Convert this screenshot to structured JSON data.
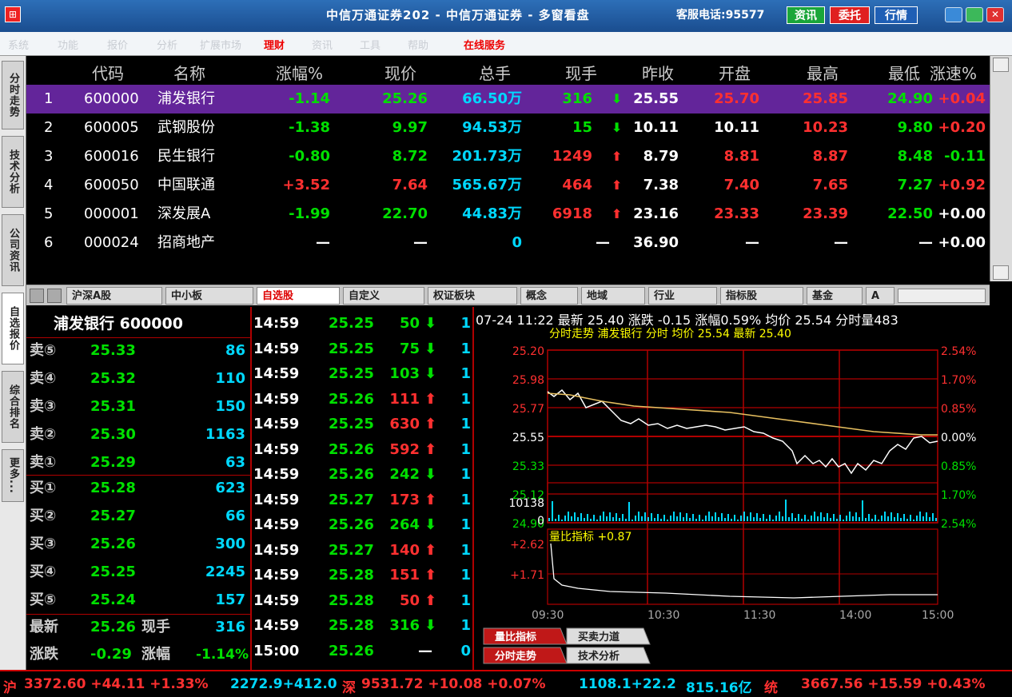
{
  "window": {
    "title": "中信万通证券202 - 中信万通证券 - 多窗看盘",
    "service_phone": "客服电话:95577",
    "btn_info": "资讯",
    "btn_order": "委托",
    "btn_quote": "行情"
  },
  "menu": {
    "items": [
      "系统",
      "功能",
      "报价",
      "分析",
      "扩展市场",
      "理财",
      "资讯",
      "工具",
      "在线服务",
      "帮助"
    ],
    "highlight_1": "理财",
    "highlight_2": "在线服务"
  },
  "left_tabs": [
    "分时走势",
    "技术分析",
    "公司资讯",
    "自选报价",
    "综合排名",
    "更多..."
  ],
  "quote_table": {
    "headers": [
      "代码",
      "名称",
      "涨幅%",
      "现价",
      "总手",
      "现手",
      "昨收",
      "开盘",
      "最高",
      "最低",
      "涨速%"
    ],
    "rows": [
      {
        "idx": "1",
        "code": "600000",
        "name": "浦发银行",
        "chg": "-1.14",
        "price": "25.26",
        "vol": "66.50万",
        "cur": "316",
        "dir": "down",
        "prev": "25.55",
        "open": "25.70",
        "high": "25.85",
        "low": "24.90",
        "speed": "+0.04"
      },
      {
        "idx": "2",
        "code": "600005",
        "name": "武钢股份",
        "chg": "-1.38",
        "price": "9.97",
        "vol": "94.53万",
        "cur": "15",
        "dir": "down",
        "prev": "10.11",
        "open": "10.11",
        "high": "10.23",
        "low": "9.80",
        "speed": "+0.20"
      },
      {
        "idx": "3",
        "code": "600016",
        "name": "民生银行",
        "chg": "-0.80",
        "price": "8.72",
        "vol": "201.73万",
        "cur": "1249",
        "dir": "up",
        "prev": "8.79",
        "open": "8.81",
        "high": "8.87",
        "low": "8.48",
        "speed": "-0.11"
      },
      {
        "idx": "4",
        "code": "600050",
        "name": "中国联通",
        "chg": "+3.52",
        "price": "7.64",
        "vol": "565.67万",
        "cur": "464",
        "dir": "up",
        "prev": "7.38",
        "open": "7.40",
        "high": "7.65",
        "low": "7.27",
        "speed": "+0.92"
      },
      {
        "idx": "5",
        "code": "000001",
        "name": "深发展A",
        "chg": "-1.99",
        "price": "22.70",
        "vol": "44.83万",
        "cur": "6918",
        "dir": "up",
        "prev": "23.16",
        "open": "23.33",
        "high": "23.39",
        "low": "22.50",
        "speed": "+0.00"
      },
      {
        "idx": "6",
        "code": "000024",
        "name": "招商地产",
        "chg": "—",
        "price": "—",
        "vol": "0",
        "cur": "—",
        "dir": "none",
        "prev": "36.90",
        "open": "—",
        "high": "—",
        "low": "—",
        "speed": "+0.00"
      }
    ]
  },
  "sheet_tabs": [
    "沪深A股",
    "中小板",
    "自选股",
    "自定义",
    "权证板块",
    "概念",
    "地域",
    "行业",
    "指标股",
    "基金",
    "A"
  ],
  "order_book": {
    "title": "浦发银行 600000",
    "sells": [
      {
        "label": "卖⑤",
        "price": "25.33",
        "vol": "86"
      },
      {
        "label": "卖④",
        "price": "25.32",
        "vol": "110"
      },
      {
        "label": "卖③",
        "price": "25.31",
        "vol": "150"
      },
      {
        "label": "卖②",
        "price": "25.30",
        "vol": "1163"
      },
      {
        "label": "卖①",
        "price": "25.29",
        "vol": "63"
      }
    ],
    "buys": [
      {
        "label": "买①",
        "price": "25.28",
        "vol": "623"
      },
      {
        "label": "买②",
        "price": "25.27",
        "vol": "66"
      },
      {
        "label": "买③",
        "price": "25.26",
        "vol": "300"
      },
      {
        "label": "买④",
        "price": "25.25",
        "vol": "2245"
      },
      {
        "label": "买⑤",
        "price": "25.24",
        "vol": "157"
      }
    ],
    "latest_label": "最新",
    "latest": "25.26",
    "cur_label": "现手",
    "cur": "316",
    "chg_label": "涨跌",
    "chg": "-0.29",
    "pct_label": "涨幅",
    "pct": "-1.14%"
  },
  "ticks": [
    {
      "t": "14:59",
      "p": "25.25",
      "v": "50",
      "d": "down",
      "n": "1"
    },
    {
      "t": "14:59",
      "p": "25.25",
      "v": "75",
      "d": "down",
      "n": "1"
    },
    {
      "t": "14:59",
      "p": "25.25",
      "v": "103",
      "d": "down",
      "n": "1"
    },
    {
      "t": "14:59",
      "p": "25.26",
      "v": "111",
      "d": "up",
      "n": "1"
    },
    {
      "t": "14:59",
      "p": "25.25",
      "v": "630",
      "d": "up",
      "n": "1"
    },
    {
      "t": "14:59",
      "p": "25.26",
      "v": "592",
      "d": "up",
      "n": "1"
    },
    {
      "t": "14:59",
      "p": "25.26",
      "v": "242",
      "d": "down",
      "n": "1"
    },
    {
      "t": "14:59",
      "p": "25.27",
      "v": "173",
      "d": "up",
      "n": "1"
    },
    {
      "t": "14:59",
      "p": "25.26",
      "v": "264",
      "d": "down",
      "n": "1"
    },
    {
      "t": "14:59",
      "p": "25.27",
      "v": "140",
      "d": "up",
      "n": "1"
    },
    {
      "t": "14:59",
      "p": "25.28",
      "v": "151",
      "d": "up",
      "n": "1"
    },
    {
      "t": "14:59",
      "p": "25.28",
      "v": "50",
      "d": "up",
      "n": "1"
    },
    {
      "t": "14:59",
      "p": "25.28",
      "v": "316",
      "d": "down",
      "n": "1"
    },
    {
      "t": "15:00",
      "p": "25.26",
      "v": "—",
      "d": "none",
      "n": "0"
    }
  ],
  "chart_info": {
    "header": "07-24 11:22 最新 25.40 涨跌 -0.15 涨幅0.59% 均价 25.54 分时量483",
    "subtitle": "分时走势 浦发银行 分时 均价 25.54 最新 25.40",
    "price_labels": [
      "25.20",
      "25.98",
      "25.77",
      "25.55",
      "25.33",
      "25.12",
      "24.90"
    ],
    "pct_labels": [
      "2.54%",
      "1.70%",
      "0.85%",
      "0.00%",
      "0.85%",
      "1.70%",
      "2.54%"
    ],
    "vol_labels": [
      "10138",
      "0"
    ],
    "ratio_title": "量比指标 +0.87",
    "ratio_labels": [
      "+2.62",
      "+1.71"
    ],
    "time_labels": [
      "09:30",
      "10:30",
      "11:30",
      "14:00",
      "15:00"
    ],
    "tabs_row1": [
      "量比指标",
      "买卖力道"
    ],
    "tabs_row2": [
      "分时走势",
      "技术分析"
    ]
  },
  "index_bar": {
    "sh_label": "沪",
    "sh": "3372.60 +44.11 +1.33%",
    "sh_amt": "2272.9+412.0",
    "sz_label": "深",
    "sz": "9531.72 +10.08 +0.07%",
    "sz_amt": "1108.1+22.2",
    "mid": "815.16亿",
    "sys_label": "统",
    "sys": "3667.56 +15.59 +0.43%"
  },
  "colors": {
    "up": "#ff3030",
    "down": "#00e000",
    "cyan": "#00d8ff",
    "white": "#ffffff",
    "yellow": "#ffff00",
    "grid": "#b00000",
    "selected": "#63259a"
  }
}
